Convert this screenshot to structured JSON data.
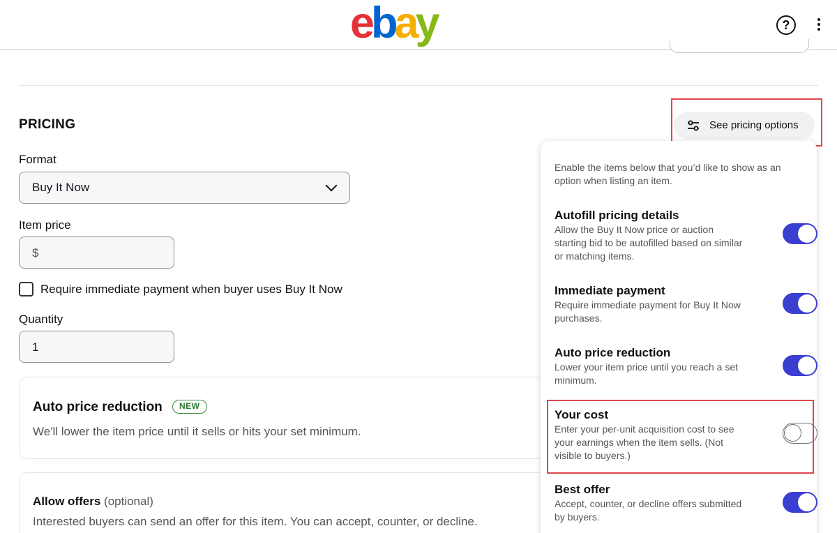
{
  "header": {
    "logo_letters": [
      {
        "ch": "e",
        "color": "#e53238"
      },
      {
        "ch": "b",
        "color": "#0064d2"
      },
      {
        "ch": "a",
        "color": "#f5af02"
      },
      {
        "ch": "y",
        "color": "#86b817"
      }
    ],
    "help_glyph": "?",
    "help_icon": "question-circle-icon",
    "more_icon": "kebab-menu-icon"
  },
  "pricing": {
    "section_title": "PRICING",
    "see_options_label": "See pricing options",
    "see_options_icon": "sliders-icon",
    "format_label": "Format",
    "format_value": "Buy It Now",
    "item_price_label": "Item price",
    "item_price_prefix": "$",
    "immediate_payment_label": "Require immediate payment when buyer uses Buy It Now",
    "immediate_payment_checked": false,
    "quantity_label": "Quantity",
    "quantity_value": "1",
    "auto_price_card": {
      "title": "Auto price reduction",
      "badge": "NEW",
      "description": "We'll lower the item price until it sells or hits your set minimum."
    },
    "allow_offers_card": {
      "title": "Allow offers",
      "optional": "(optional)",
      "description": "Interested buyers can send an offer for this item. You can accept, counter, or decline."
    }
  },
  "options_panel": {
    "intro": "Enable the items below that you’d like to show as an option when listing an item.",
    "options": [
      {
        "title": "Autofill pricing details",
        "description": "Allow the Buy It Now price or auction starting bid to be autofilled based on similar or matching items.",
        "enabled": true
      },
      {
        "title": "Immediate payment",
        "description": "Require immediate payment for Buy It Now purchases.",
        "enabled": true
      },
      {
        "title": "Auto price reduction",
        "description": "Lower your item price until you reach a set minimum.",
        "enabled": true
      },
      {
        "title": "Your cost",
        "description": "Enter your per-unit acquisition cost to see your earnings when the item sells. (Not visible to buyers.)",
        "enabled": false
      },
      {
        "title": "Best offer",
        "description": "Accept, counter, or decline offers submitted by buyers.",
        "enabled": true
      }
    ]
  },
  "colors": {
    "toggle_on": "#3b3fd1",
    "highlight": "#e0474c",
    "badge_green": "#2f7a33"
  }
}
